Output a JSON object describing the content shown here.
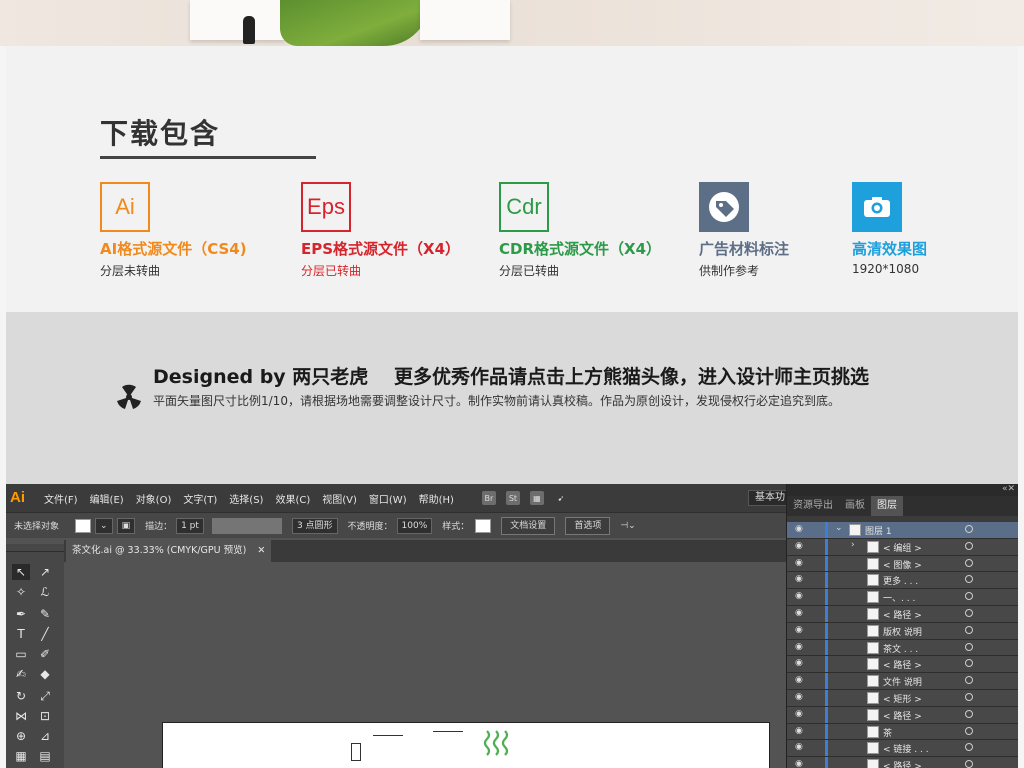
{
  "download": {
    "heading": "下载包含",
    "formats": [
      {
        "icon": "Ai",
        "title": "AI格式源文件（CS4)",
        "sub": "分层未转曲",
        "color": "#f08a1c"
      },
      {
        "icon": "Eps",
        "title": "EPS格式源文件（X4）",
        "sub": "分层已转曲",
        "color": "#d5242c"
      },
      {
        "icon": "Cdr",
        "title": "CDR格式源文件（X4）",
        "sub": "分层已转曲",
        "color": "#2c9a48"
      },
      {
        "icon": "tag-icon",
        "title": "广告材料标注",
        "sub": "供制作参考",
        "color": "#5d6e87"
      },
      {
        "icon": "camera-icon",
        "title": "高清效果图",
        "sub": "1920*1080",
        "color": "#1ea0dc"
      }
    ]
  },
  "banner": {
    "designed_by": "Designed by 两只老虎",
    "more": "更多优秀作品请点击上方熊猫头像，进入设计师主页挑选",
    "note": "平面矢量图尺寸比例1/10，请根据场地需要调整设计尺寸。制作实物前请认真校稿。作品为原创设计，发现侵权行必定追究到底。"
  },
  "illustrator": {
    "logo": "Ai",
    "menu": [
      "文件(F)",
      "编辑(E)",
      "对象(O)",
      "文字(T)",
      "选择(S)",
      "效果(C)",
      "视图(V)",
      "窗口(W)",
      "帮助(H)"
    ],
    "app_icons": [
      "Br",
      "St"
    ],
    "workspace": "基本功",
    "control": {
      "selection": "未选择对象",
      "stroke_label": "描边：",
      "stroke_value": "1 pt",
      "brush": "3 点圆形",
      "opacity_label": "不透明度：",
      "opacity_value": "100%",
      "style_label": "样式：",
      "doc_setup": "文档设置",
      "prefs": "首选项"
    },
    "doc_tab": "茶文化.ai @ 33.33% (CMYK/GPU 预览)",
    "panel_tabs": [
      "资源导出",
      "画板",
      "图层"
    ],
    "active_panel_tab": "图层",
    "layers": [
      {
        "name": "图层 1",
        "top": true
      },
      {
        "name": "< 编组 >",
        "expand": true
      },
      {
        "name": "< 图像 >"
      },
      {
        "name": "更多 . . ."
      },
      {
        "name": "一、. . ."
      },
      {
        "name": "< 路径 >"
      },
      {
        "name": "版权 说明"
      },
      {
        "name": "茶文 . . ."
      },
      {
        "name": "< 路径 >"
      },
      {
        "name": "文件 说明"
      },
      {
        "name": "< 矩形 >"
      },
      {
        "name": "< 路径 >"
      },
      {
        "name": "茶"
      },
      {
        "name": "< 链接 . . ."
      },
      {
        "name": "< 路径 >"
      }
    ]
  }
}
